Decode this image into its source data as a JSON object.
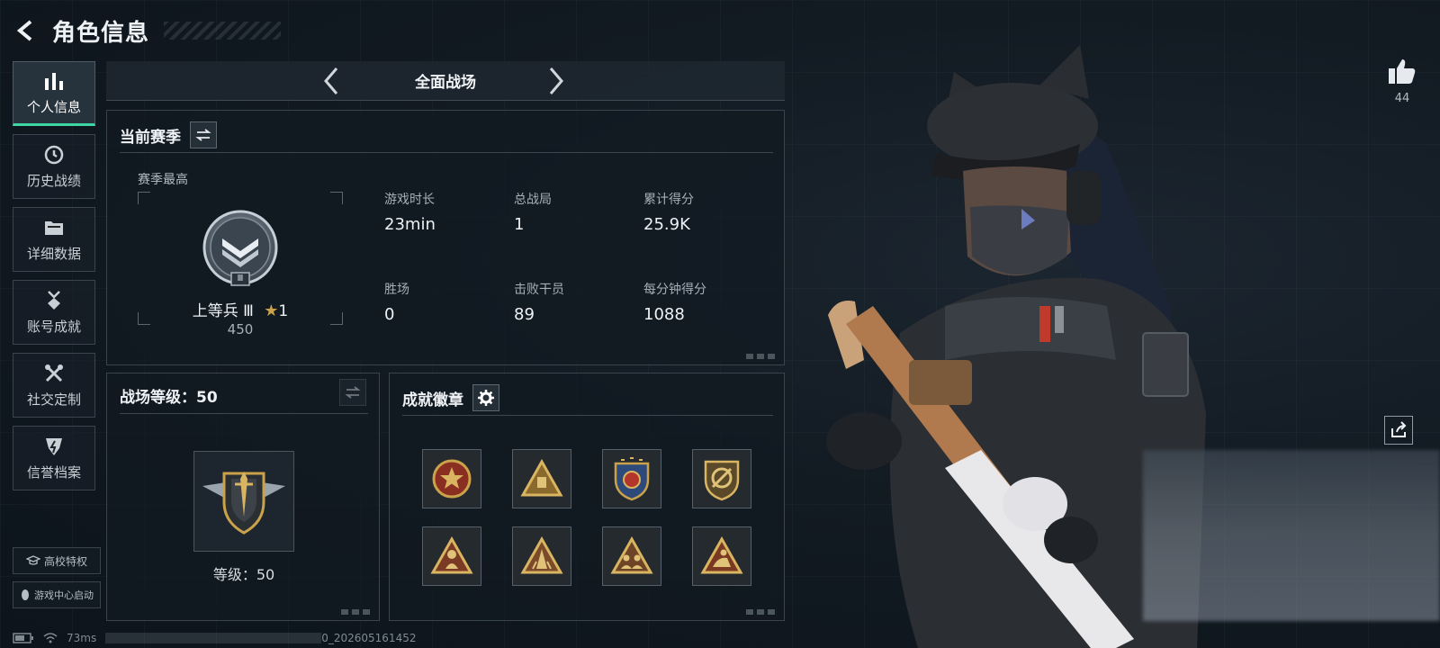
{
  "header": {
    "title": "角色信息"
  },
  "sidebar": {
    "items": [
      {
        "label": "个人信息",
        "icon": "bar-chart-icon",
        "active": true
      },
      {
        "label": "历史战绩",
        "icon": "history-clock-icon"
      },
      {
        "label": "详细数据",
        "icon": "folder-icon"
      },
      {
        "label": "账号成就",
        "icon": "medal-icon"
      },
      {
        "label": "社交定制",
        "icon": "tools-icon"
      },
      {
        "label": "信誉档案",
        "icon": "credit-shield-icon"
      }
    ],
    "campus": "高校特权",
    "game_center": "游戏中心启动"
  },
  "mode": {
    "title": "全面战场"
  },
  "season": {
    "title": "当前赛季",
    "best_label": "赛季最高",
    "rank_name": "上等兵 Ⅲ",
    "rank_stars": "1",
    "rank_score": "450",
    "rank_emblem_numeral": "Ⅲ",
    "stats": [
      {
        "label": "游戏时长",
        "value": "23min"
      },
      {
        "label": "总战局",
        "value": "1"
      },
      {
        "label": "累计得分",
        "value": "25.9K"
      },
      {
        "label": "胜场",
        "value": "0"
      },
      {
        "label": "击败干员",
        "value": "89"
      },
      {
        "label": "每分钟得分",
        "value": "1088"
      }
    ]
  },
  "battle_level": {
    "title": "战场等级：50",
    "level_text": "等级：50"
  },
  "achievements": {
    "title": "成就徽章",
    "badges": [
      "star-wreath-badge-icon",
      "supply-triangle-badge-icon",
      "eagle-shield-badge-icon",
      "compass-shield-badge-icon",
      "soldier-triangle-badge-icon",
      "squad-triangle-badge-icon",
      "troops-triangle-badge-icon",
      "rider-triangle-badge-icon"
    ]
  },
  "social": {
    "likes": "44"
  },
  "status": {
    "ping": "73ms",
    "session_id": "0_202605161452"
  },
  "colors": {
    "accent": "#3dd6a4",
    "gold": "#c9a24a",
    "panel_border": "#3a444e"
  }
}
